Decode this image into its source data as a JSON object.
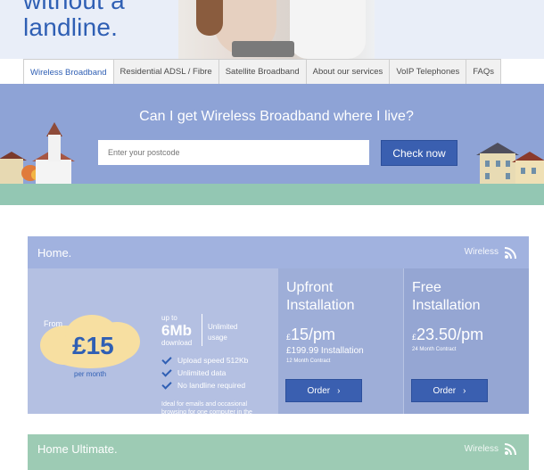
{
  "hero": {
    "title": "without a landline."
  },
  "tabs": [
    {
      "label": "Wireless Broadband"
    },
    {
      "label": "Residential ADSL / Fibre"
    },
    {
      "label": "Satellite Broadband"
    },
    {
      "label": "About our services"
    },
    {
      "label": "VoIP Telephones"
    },
    {
      "label": "FAQs"
    }
  ],
  "search": {
    "question": "Can I get Wireless Broadband where I live?",
    "placeholder": "Enter your postcode",
    "button": "Check now"
  },
  "plan": {
    "title": "Home.",
    "tag": "Wireless",
    "from_label": "From",
    "price": "£15",
    "per_month": "per month",
    "up_to": "up to",
    "speed": "6Mb",
    "speed_unit": "download",
    "usage_line1": "Unlimited",
    "usage_line2": "usage",
    "features": [
      "Upload speed 512Kb",
      "Unlimited data",
      "No landline required"
    ],
    "note": "Ideal for emails and occasional browsing for one computer in the household.",
    "upfront": {
      "title_line1": "Upfront",
      "title_line2": "Installation",
      "currency": "£",
      "price": "15",
      "unit": "/pm",
      "installation": "£199.99 Installation",
      "contract": "12 Month Contract",
      "button": "Order"
    },
    "free": {
      "title_line1": "Free",
      "title_line2": "Installation",
      "currency": "£",
      "price": "23.50",
      "unit": "/pm",
      "contract": "24 Month Contract",
      "button": "Order"
    }
  },
  "plan2": {
    "title": "Home Ultimate.",
    "tag": "Wireless"
  },
  "colors": {
    "accent": "#3a5fb0",
    "band": "#8ea3d6",
    "cloud": "#f7dfa1",
    "ground": "#93c7b3"
  }
}
